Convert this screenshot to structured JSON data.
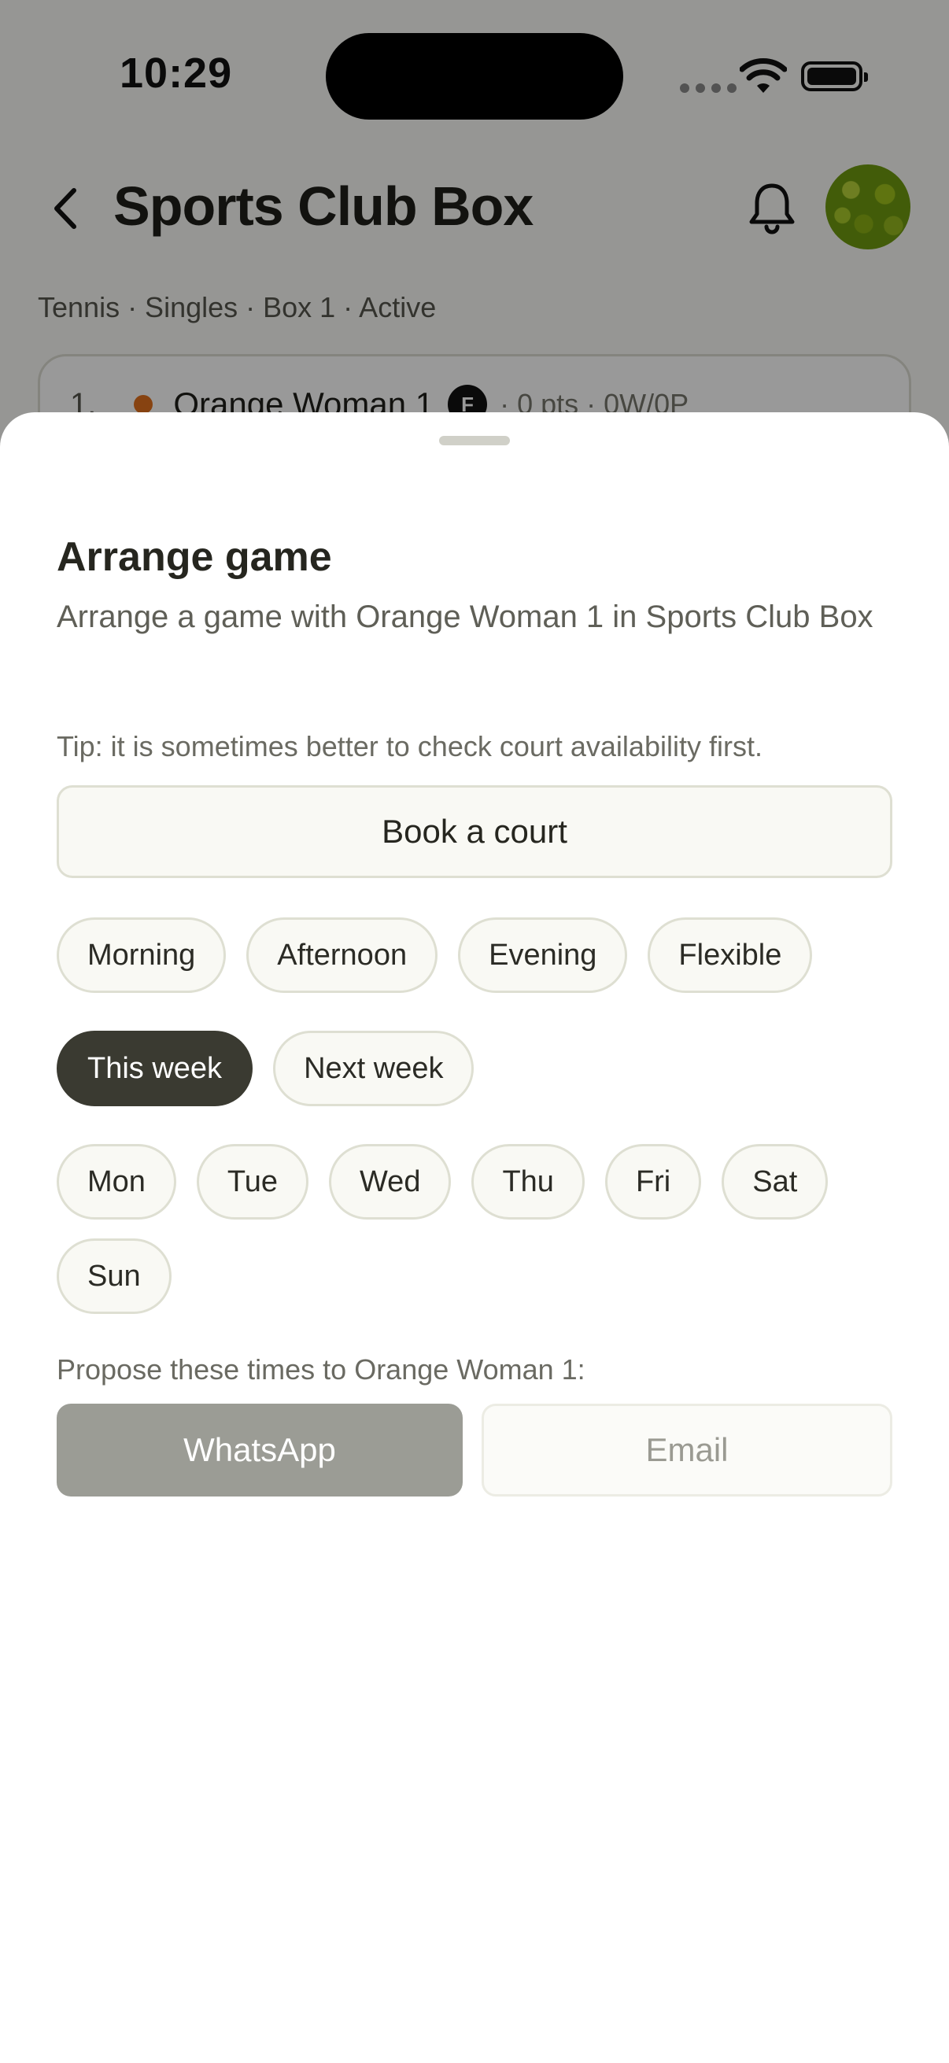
{
  "status_bar": {
    "time": "10:29"
  },
  "header": {
    "title": "Sports Club Box"
  },
  "box_info": {
    "subtitle": "Tennis · Singles · Box 1 · Active"
  },
  "standings": [
    {
      "rank": "1.",
      "name": "Orange Woman 1",
      "badge": "F",
      "stats": "· 0 pts · 0W/0P"
    }
  ],
  "sheet": {
    "title": "Arrange game",
    "description": "Arrange a game with Orange Woman 1 in Sports Club Box",
    "tip": "Tip: it is sometimes better to check court availability first.",
    "book_court_label": "Book a court",
    "time_of_day": [
      "Morning",
      "Afternoon",
      "Evening",
      "Flexible"
    ],
    "weeks": [
      {
        "label": "This week",
        "selected": true
      },
      {
        "label": "Next week",
        "selected": false
      }
    ],
    "days": [
      "Mon",
      "Tue",
      "Wed",
      "Thu",
      "Fri",
      "Sat",
      "Sun"
    ],
    "propose_text": "Propose these times to Orange Woman 1:",
    "whatsapp_label": "WhatsApp",
    "email_label": "Email"
  },
  "colors": {
    "accent_dark": "#3a3a31",
    "player_dot": "#e2711d",
    "whatsapp_disabled": "#9b9c95"
  }
}
